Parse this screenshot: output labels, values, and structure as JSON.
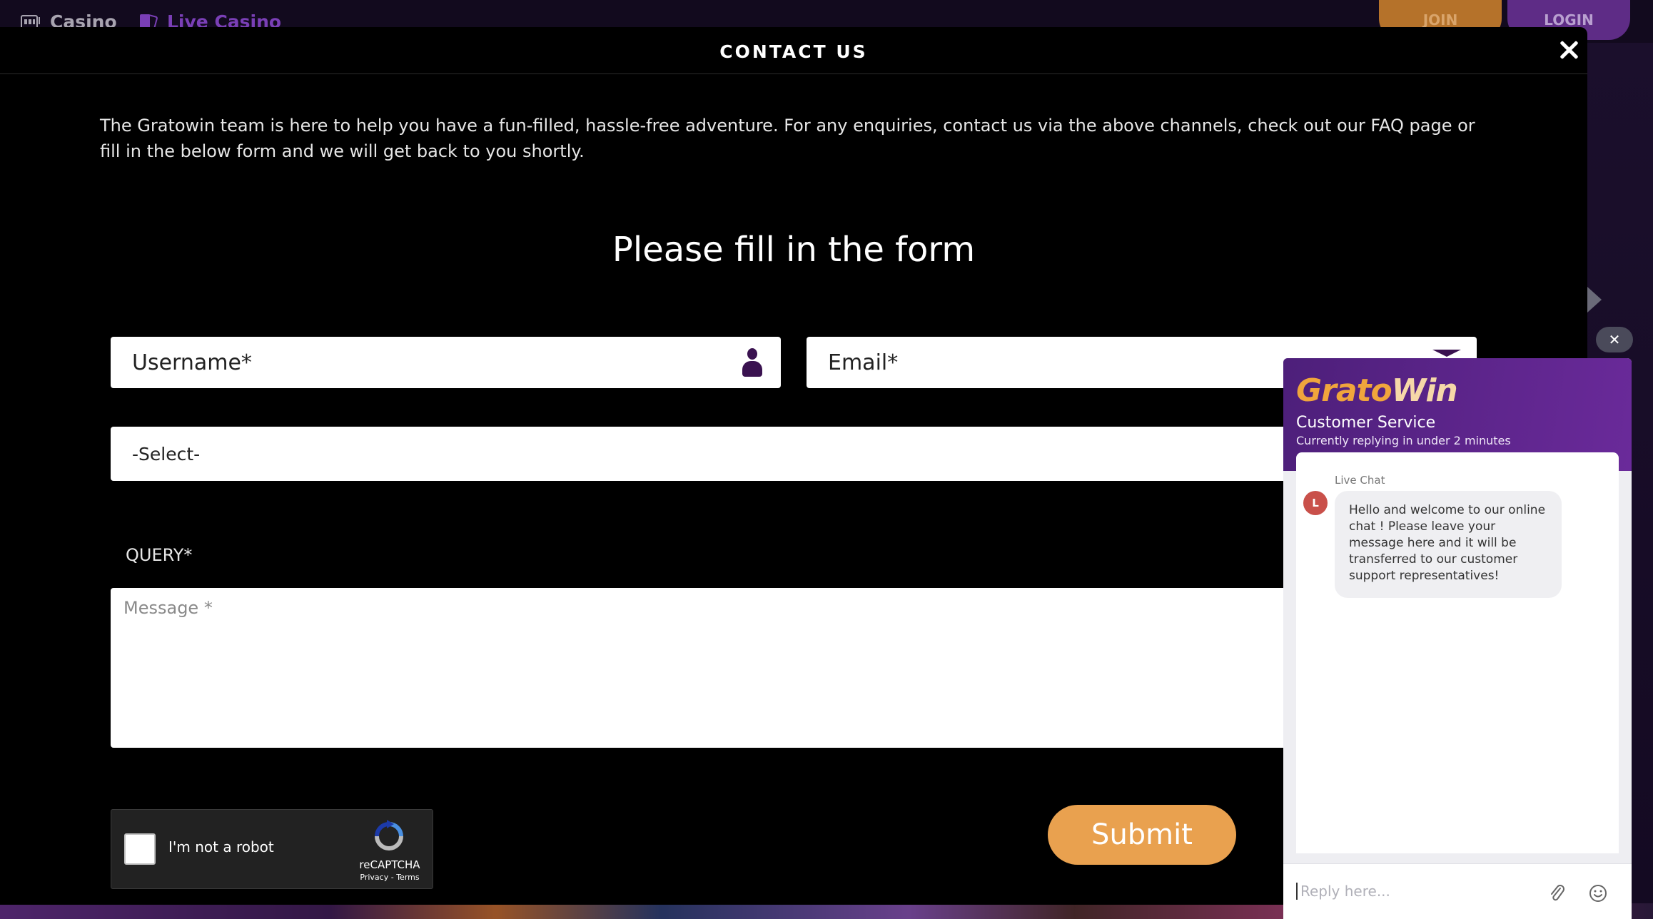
{
  "site_nav": {
    "casino_label": "Casino",
    "live_casino_label": "Live Casino",
    "join_label": "JOIN",
    "login_label": "LOGIN"
  },
  "modal": {
    "title": "CONTACT US",
    "intro": "The Gratowin team is here to help you have a fun-filled, hassle-free adventure. For any enquiries, contact us via the above channels, check out our FAQ page or fill in the below form and we will get back to you shortly.",
    "form_heading": "Please fill in the form",
    "username_placeholder": "Username*",
    "email_placeholder": "Email*",
    "select_value": "-Select-",
    "query_label": "QUERY*",
    "message_placeholder": "Message *",
    "recaptcha": {
      "label": "I'm not a robot",
      "brand": "reCAPTCHA",
      "links": "Privacy - Terms"
    },
    "submit_label": "Submit"
  },
  "chat": {
    "dismiss_label": "✕",
    "logo_part1": "Grato",
    "logo_part2": "Win",
    "title": "Customer Service",
    "subtitle": "Currently replying in under 2 minutes",
    "sender": "Live Chat",
    "avatar_initial": "L",
    "message": "Hello and welcome to our online chat ! Please leave your message here and it will be transferred to our customer support representatives!",
    "input_placeholder": "Reply here..."
  },
  "colors": {
    "accent_orange": "#e9a14f",
    "brand_purple": "#5e2c86",
    "icon_purple": "#3a1250"
  }
}
